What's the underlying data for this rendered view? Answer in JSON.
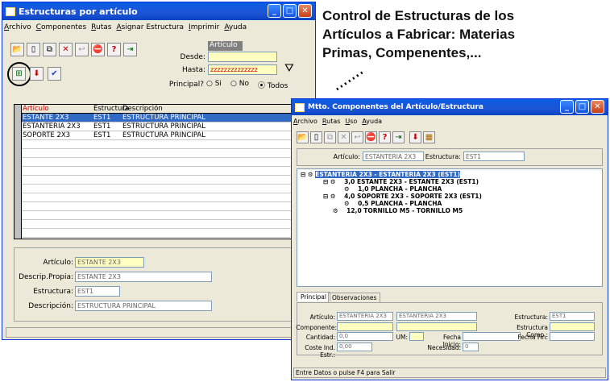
{
  "caption": {
    "line1": "Control de Estructuras de los",
    "line2": "Artículos a Fabricar: Materias",
    "line3": "Primas, Compenentes,..."
  },
  "win1": {
    "title": "Estructuras por artículo",
    "menu": [
      "Archivo",
      "Componentes",
      "Rutas",
      "Asignar Estructura",
      "Imprimir",
      "Ayuda"
    ],
    "filter": {
      "box_title": "Artículo",
      "desde_label": "Desde:",
      "desde_value": "",
      "hasta_label": "Hasta:",
      "hasta_value": "zzzzzzzzzzzzzz",
      "principal_label": "Principal?",
      "opt_si": "Si",
      "opt_no": "No",
      "opt_todos": "Todos",
      "selected": "Todos"
    },
    "columns": [
      "Artículo",
      "Estructura",
      "Descripción"
    ],
    "rows": [
      [
        "ESTANTE 2X3",
        "EST1",
        "ESTRUCTURA PRINCIPAL"
      ],
      [
        "ESTANTERIA 2X3",
        "EST1",
        "ESTRUCTURA PRINCIPAL"
      ],
      [
        "SOPORTE 2X3",
        "EST1",
        "ESTRUCTURA PRINCIPAL"
      ]
    ],
    "detail": {
      "articulo_label": "Artículo:",
      "articulo_value": "ESTANTE 2X3",
      "descrip_label": "Descrip.Propia:",
      "descrip_value": "ESTANTE 2X3",
      "estructura_label": "Estructura:",
      "estructura_value": "EST1",
      "descripcion_label": "Descripción:",
      "descripcion_value": "ESTRUCTURA PRINCIPAL"
    }
  },
  "win2": {
    "title": "Mtto. Componentes del Artículo/Estructura",
    "menu": [
      "Archivo",
      "Rutas",
      "Uso",
      "Ayuda"
    ],
    "articulo_label": "Artículo:",
    "articulo_value": "ESTANTERIA 2X3",
    "estructura_label": "Estructura:",
    "estructura_value": "EST1",
    "tree": [
      "ESTANTERIA 2X3 - ESTANTERIA 2X3 (EST1)",
      "3,0 ESTANTE 2X3 - ESTANTE 2X3 (EST1)",
      "1,0 PLANCHA - PLANCHA",
      "4,0 SOPORTE 2X3 - SOPORTE 2X3 (EST1)",
      "0,5 PLANCHA - PLANCHA",
      "12,0 TORNILLO M5 - TORNILLO M5"
    ],
    "tabs": [
      "Principal",
      "Observaciones"
    ],
    "form": {
      "articulo_label": "Artículo:",
      "articulo_code": "ESTANTERIA 2X3",
      "articulo_desc": "ESTANTERIA 2X3",
      "componente_label": "Componente:",
      "cantidad_label": "Cantidad:",
      "cantidad_value": "0,0",
      "um_label": "UM:",
      "fecha_inicio_label": "Fecha Inicio:",
      "coste_label": "Coste Ind. Estr.:",
      "coste_value": "0,00",
      "necesidad_label": "Necesidad:",
      "necesidad_value": "0",
      "estructura_label": "Estructura:",
      "estructura_value": "EST1",
      "estructura_comp_label": "Estructura Comp.:",
      "fecha_fin_label": "Fecha Fin:"
    },
    "status": "Entre Datos o pulse F4 para Salir"
  }
}
